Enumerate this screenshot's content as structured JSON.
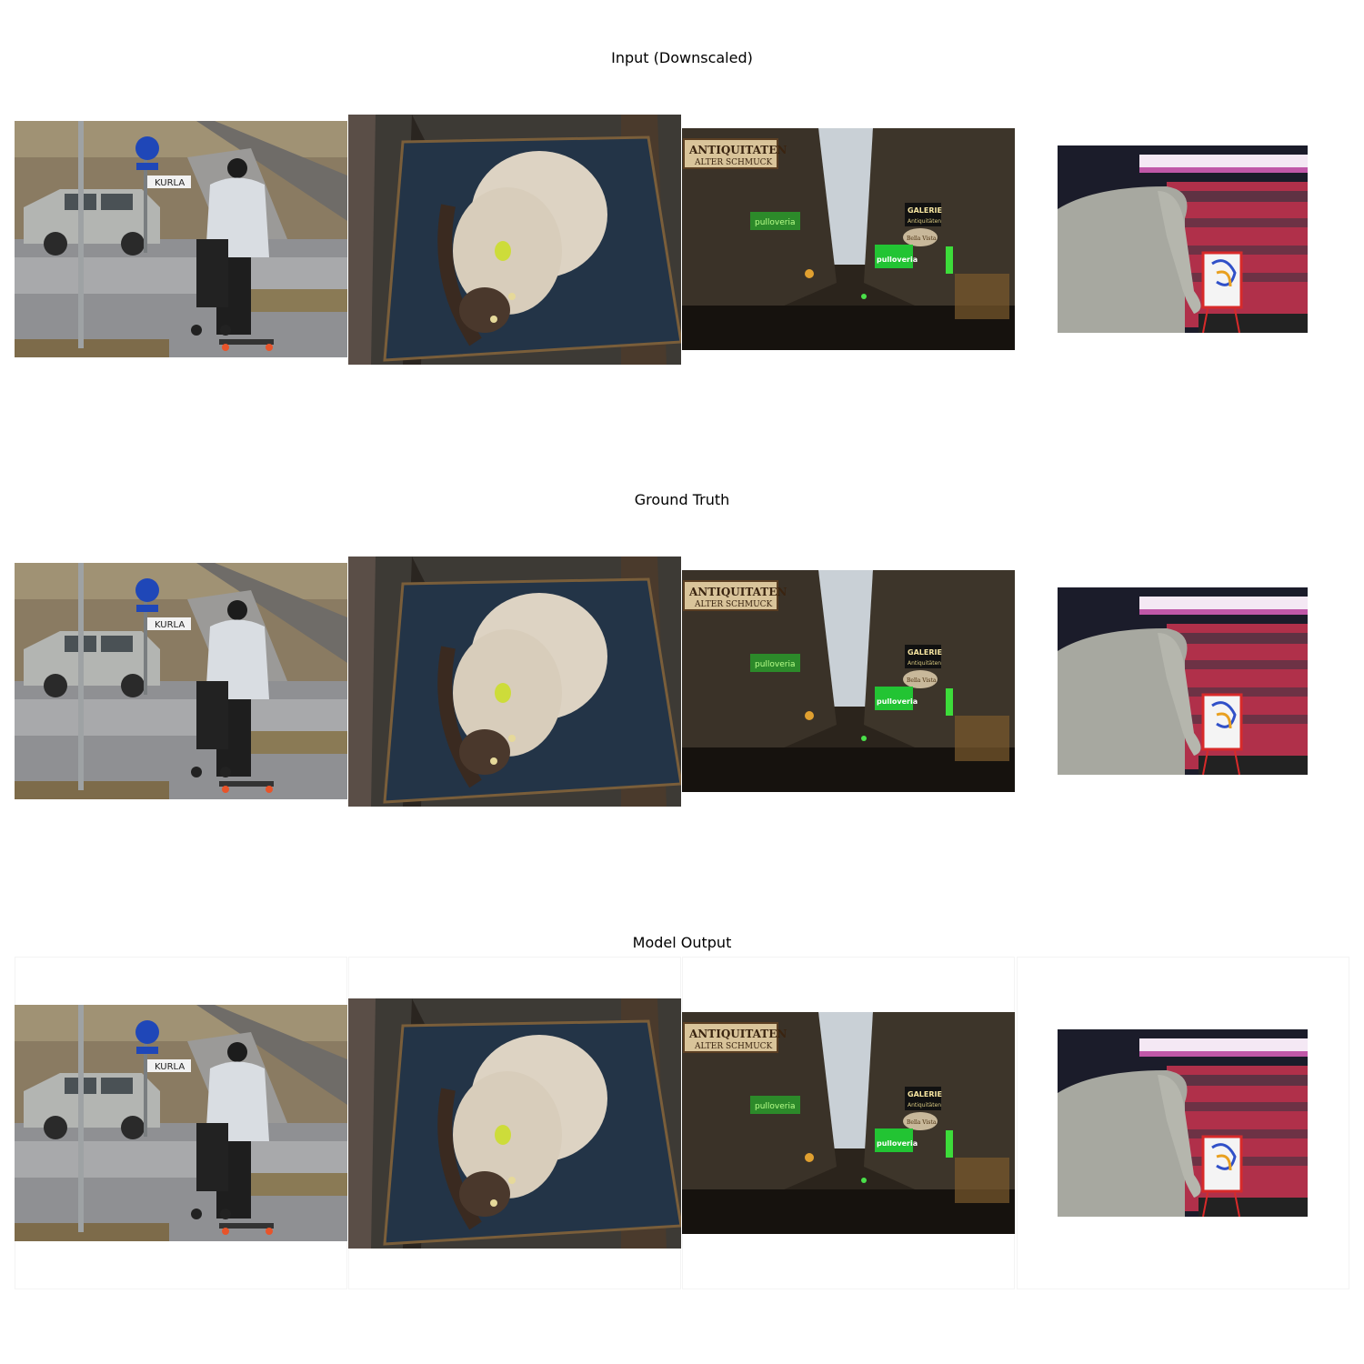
{
  "rows": [
    {
      "title": "Input (Downscaled)"
    },
    {
      "title": "Ground Truth"
    },
    {
      "title": "Model Output"
    }
  ],
  "street_sign": {
    "text": "KURLA"
  },
  "alley_signs": {
    "shop": "ANTIQUITATEN",
    "shop_sub": "ALTER SCHMUCK",
    "gallery": "GALERIE",
    "gallery_sub": "Antiquitäten",
    "green_sign": "pulloveria",
    "oval_sign": "Bella Vista"
  },
  "palette": {
    "sky": "#c9d0d6",
    "green_sign": "#22c433",
    "elephant": "#a7a8a0",
    "crowd": "#b0304a"
  }
}
